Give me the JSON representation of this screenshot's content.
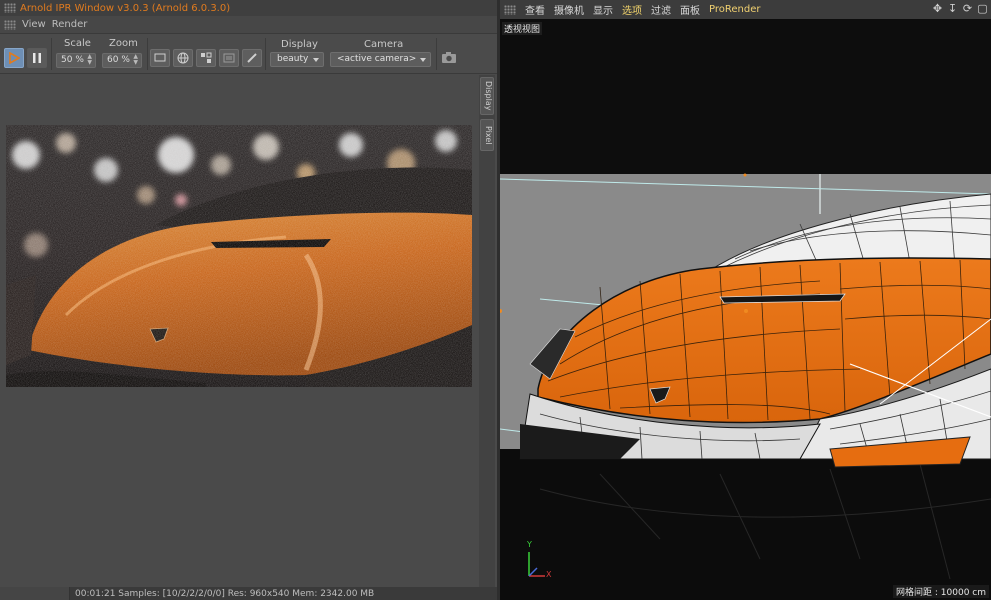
{
  "ipr": {
    "title": "Arnold IPR Window v3.0.3 (Arnold 6.0.3.0)",
    "menu": [
      "View",
      "Render"
    ],
    "toolbar": {
      "scale_label": "Scale",
      "scale_value": "50 %",
      "zoom_label": "Zoom",
      "zoom_value": "60 %",
      "display_label": "Display",
      "display_value": "beauty",
      "camera_label": "Camera",
      "camera_value": "<active camera>"
    },
    "side_tabs": [
      "Display",
      "Pixel"
    ],
    "status": "00:01:21  Samples: [10/2/2/2/0/0]  Res: 960x540  Mem: 2342.00 MB"
  },
  "viewport": {
    "menu": [
      "查看",
      "摄像机",
      "显示",
      "选项",
      "过滤",
      "面板",
      "ProRender"
    ],
    "active_menu_index": 3,
    "label": "透视视图",
    "grid_label": "网格间距 : 10000 cm",
    "axis": {
      "y": "Y",
      "x": "X"
    }
  },
  "colors": {
    "accent_orange": "#e07b1f",
    "car_orange": "#e66d10",
    "active_menu": "#f1d36b",
    "play_button": "#6e8fb5"
  },
  "icons": [
    "play-icon",
    "pause-icon",
    "monitor-icon",
    "globe-icon",
    "region-icon",
    "list-icon",
    "brush-icon",
    "camera-icon",
    "move-icon",
    "arrow-down-icon",
    "rotate-icon",
    "maximize-icon"
  ]
}
